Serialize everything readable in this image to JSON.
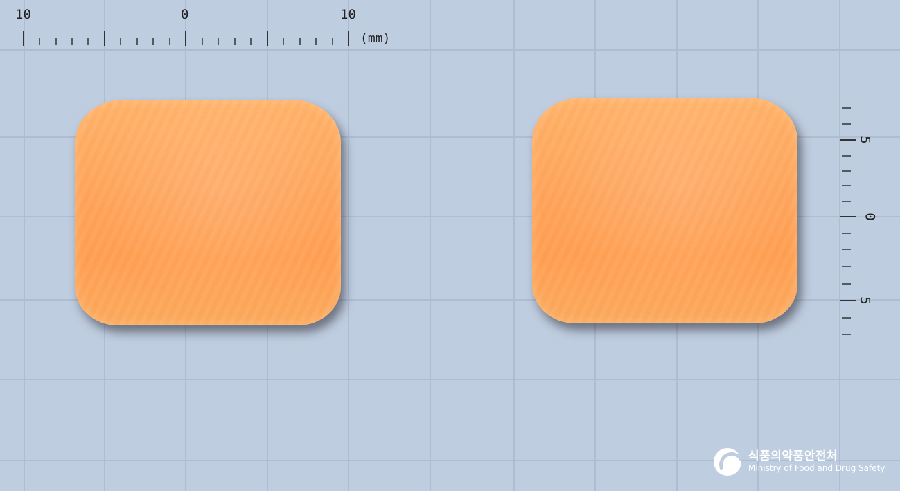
{
  "scene": {
    "background_color": "#bfcde0",
    "grid_color": "#aab8cc",
    "tablet_color": "#fea35a"
  },
  "ruler_top": {
    "labels": [
      "10",
      "0",
      "10"
    ],
    "unit": "(mm)"
  },
  "ruler_right": {
    "labels": [
      "5",
      "0",
      "5"
    ]
  },
  "logo": {
    "korean": "식품의약품안전처",
    "english": "Ministry of Food and Drug Safety"
  }
}
